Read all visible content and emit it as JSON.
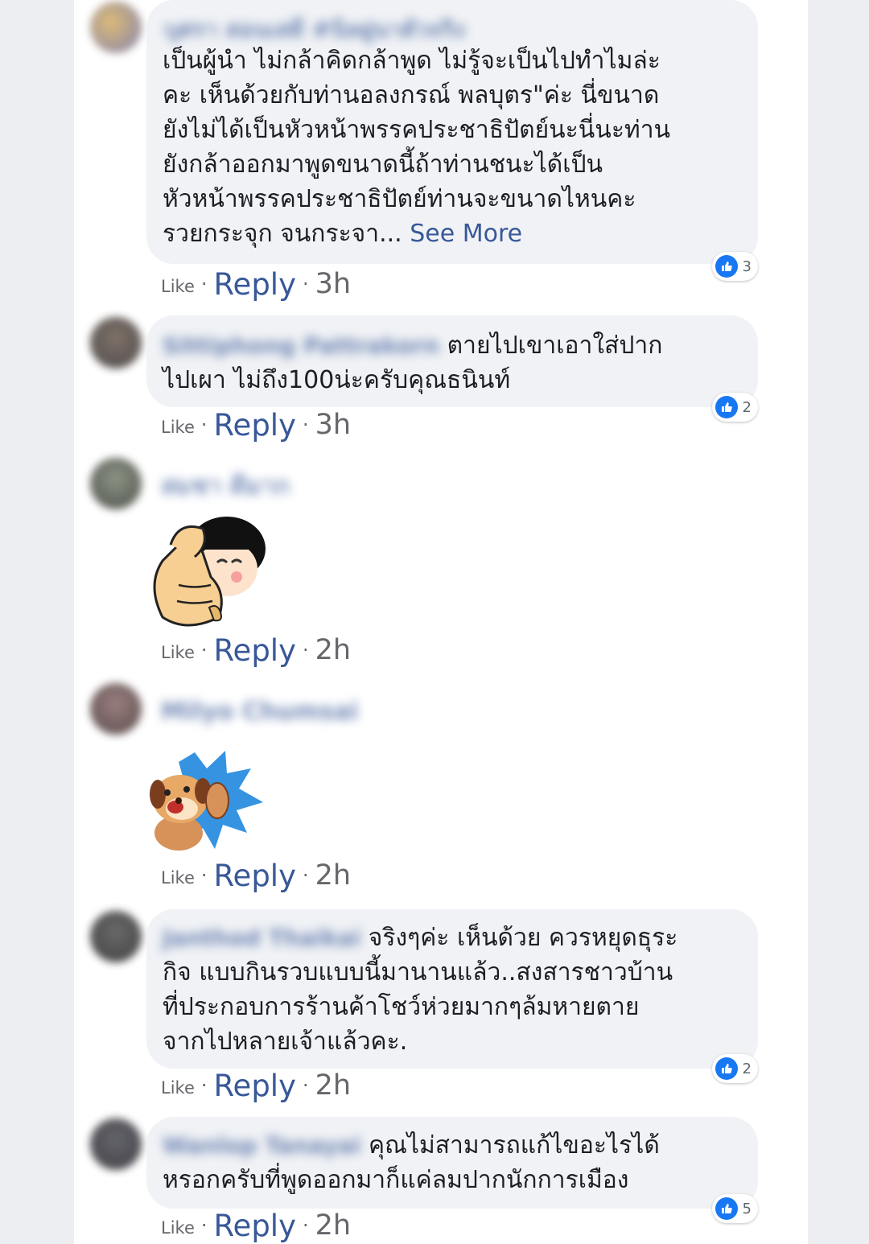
{
  "comments": [
    {
      "author": "บุศรา สอนเสดี #นิลฝูนาตัวจริง",
      "text": "เป็นผู้นำ ไม่กล้าคิดกล้าพูด ไม่รู้จะเป็นไปทำไมล่ะ\nคะ เห็นด้วยกับท่านอลงกรณ์ พลบุตร\"ค่ะ นี่ขนาด\nยังไม่ได้เป็นหัวหน้าพรรคประชาธิปัตย์นะนี่นะท่าน\nยังกล้าออกมาพูดขนาดนี้ถ้าท่านชนะได้เป็น\nหัวหน้าพรรคประชาธิปัตย์ท่านจะขนาดไหนคะ\nรวยกระจุก จนกระจา...",
      "see_more": "See More",
      "reactions": "3",
      "like": "Like",
      "reply": "Reply",
      "time": "3h"
    },
    {
      "author": "Sittiphong Pattrakorn",
      "text": "ตายไปเขาเอาใส่ปาก\nไปเผา ไม่ถึง100น่ะครับคุณธนินท์",
      "reactions": "2",
      "like": "Like",
      "reply": "Reply",
      "time": "3h"
    },
    {
      "author": "สมชา ดีมาก",
      "sticker": "thumbs-up-girl-sticker",
      "like": "Like",
      "reply": "Reply",
      "time": "2h"
    },
    {
      "author": "Milyo Chumsai",
      "sticker": "dog-thumbs-up-sticker",
      "like": "Like",
      "reply": "Reply",
      "time": "2h"
    },
    {
      "author": "Janthod Thaikai",
      "text": "จริงๆค่ะ เห็นด้วย ควรหยุดธุระ\nกิจ แบบกินรวบแบบนี้มานานแล้ว..สงสารชาวบ้าน\nที่ประกอบการร้านค้าโชว์ห่วยมากๆล้มหายตาย\nจากไปหลายเจ้าแล้วคะ.",
      "reactions": "2",
      "like": "Like",
      "reply": "Reply",
      "time": "2h"
    },
    {
      "author": "Wanlop Tanayai",
      "text": "คุณไม่สามารถแก้ไขอะไรได้\nหรอกครับที่พูดออกมาก็แค่ลมปากนักการเมือง",
      "reactions": "5",
      "like": "Like",
      "reply": "Reply",
      "time": "2h"
    }
  ],
  "colors": {
    "link": "#385898",
    "bubble": "#f0f2f5",
    "like_icon": "#1877f2",
    "meta": "#65676b"
  }
}
